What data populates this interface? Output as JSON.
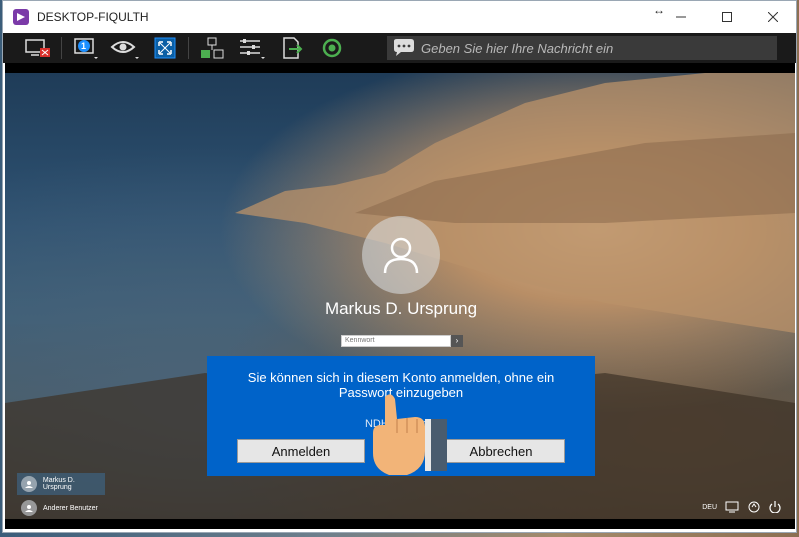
{
  "window": {
    "title": "DESKTOP-FIQULTH",
    "minimize_glyph": "—",
    "maximize_glyph": "☐",
    "close_glyph": "✕",
    "resize_glyph": "↔"
  },
  "toolbar": {
    "monitor_badge": "1",
    "chat_placeholder": "Geben Sie hier Ihre Nachricht ein"
  },
  "lockscreen": {
    "user_name": "Markus D. Ursprung",
    "password_placeholder": "Kennwort",
    "submit_glyph": "›",
    "language": "DEU"
  },
  "dialog": {
    "message": "Sie können sich in diesem Konto anmelden, ohne ein Passwort einzugeben",
    "sub_text": "NDHM Markus",
    "ok_label": "Anmelden",
    "cancel_label": "Abbrechen"
  },
  "user_list": [
    {
      "label": "Markus D. Ursprung",
      "selected": true
    },
    {
      "label": "Anderer Benutzer",
      "selected": false
    }
  ],
  "colors": {
    "dialog_bg": "#0063c9",
    "toolbar_bg": "#1a1a1a",
    "app_icon": "#7b3aa8",
    "accent": "#1e90ff"
  }
}
